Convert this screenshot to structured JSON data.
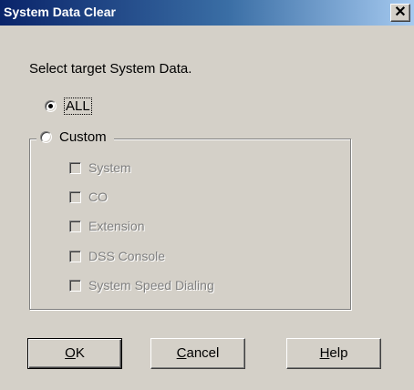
{
  "window": {
    "title": "System Data Clear",
    "close_glyph": "✕"
  },
  "prompt": "Select target System Data.",
  "options": {
    "all_label": "ALL",
    "all_selected": true,
    "custom_label": "Custom",
    "custom_selected": false
  },
  "custom_items": [
    {
      "label": "System",
      "checked": false,
      "enabled": false
    },
    {
      "label": "CO",
      "checked": false,
      "enabled": false
    },
    {
      "label": "Extension",
      "checked": false,
      "enabled": false
    },
    {
      "label": "DSS Console",
      "checked": false,
      "enabled": false
    },
    {
      "label": "System Speed Dialing",
      "checked": false,
      "enabled": false
    }
  ],
  "buttons": {
    "ok": {
      "mnemonic": "O",
      "rest": "K"
    },
    "cancel": {
      "mnemonic": "C",
      "rest": "ancel"
    },
    "help": {
      "mnemonic": "H",
      "rest": "elp"
    }
  }
}
